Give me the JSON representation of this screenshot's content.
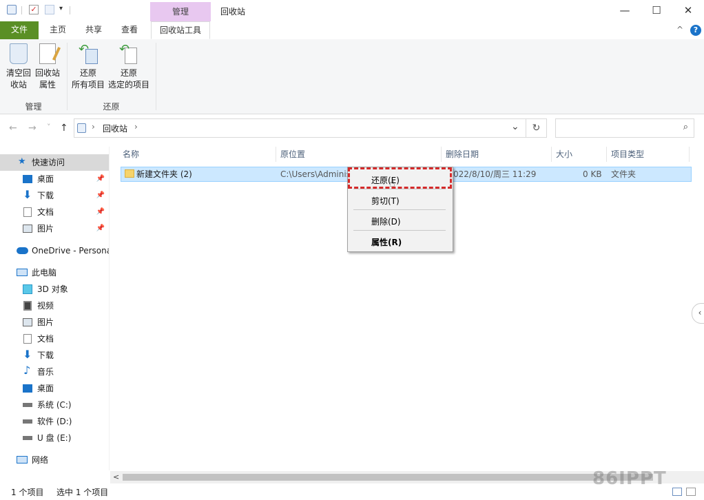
{
  "titlebar": {
    "context_tab": "管理",
    "title": "回收站",
    "quick_access_icons": [
      "recycle-bin-icon",
      "checkmark-properties-icon",
      "new-folder-icon",
      "customize-dropdown-icon"
    ],
    "minimize": "—",
    "maximize": "☐",
    "close": "✕"
  },
  "ribbon_tabs": {
    "file": "文件",
    "home": "主页",
    "share": "共享",
    "view": "查看",
    "recycle_tools": "回收站工具",
    "collapse": "^",
    "help": "?"
  },
  "ribbon": {
    "empty_line1": "清空回",
    "empty_line2": "收站",
    "props_line1": "回收站",
    "props_line2": "属性",
    "manage_label": "管理",
    "restore_all_line1": "还原",
    "restore_all_line2": "所有项目",
    "restore_sel_line1": "还原",
    "restore_sel_line2": "选定的项目",
    "restore_label": "还原"
  },
  "address": {
    "back": "←",
    "forward": "→",
    "recent": "˅",
    "up": "↑",
    "sep": "›",
    "location": "回收站",
    "dropdown": "⌄",
    "refresh": "↻",
    "search_placeholder": ""
  },
  "sidebar": {
    "quick_access": "快速访问",
    "desktop": "桌面",
    "downloads": "下载",
    "documents": "文档",
    "pictures": "图片",
    "onedrive": "OneDrive - Persona",
    "this_pc": "此电脑",
    "objects_3d": "3D 对象",
    "videos": "视频",
    "pictures2": "图片",
    "documents2": "文档",
    "downloads2": "下载",
    "music": "音乐",
    "desktop2": "桌面",
    "drive_c": "系统 (C:)",
    "drive_d": "软件 (D:)",
    "drive_e": "U 盘 (E:)",
    "network": "网络"
  },
  "columns": {
    "name": "名称",
    "original_location": "原位置",
    "date_deleted": "删除日期",
    "size": "大小",
    "item_type": "项目类型"
  },
  "rows": [
    {
      "name": "新建文件夹 (2)",
      "location": "C:\\Users\\Adminis",
      "date": "022/8/10/周三 11:29",
      "size": "0 KB",
      "type": "文件夹"
    }
  ],
  "context_menu": {
    "restore": "还原(E)",
    "cut": "剪切(T)",
    "delete": "删除(D)",
    "properties": "属性(R)"
  },
  "status": {
    "count": "1 个项目",
    "selected": "选中 1 个项目"
  },
  "watermark": "86IPPT",
  "colors": {
    "file_tab": "#5a8f25",
    "context_tab": "#e8c8f0",
    "selection": "#cce8ff",
    "highlight": "#d42a2a"
  }
}
